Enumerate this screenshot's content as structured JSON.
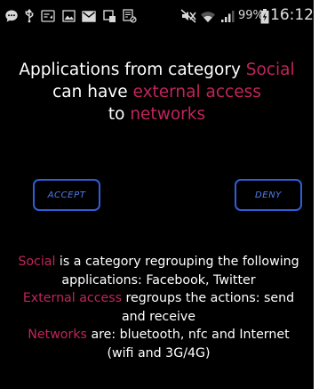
{
  "status_bar": {
    "icons": [
      "chat-bubble-icon",
      "usb-icon",
      "voicemail-icon",
      "image-icon",
      "mail-icon",
      "screen-share-icon",
      "blocked-app-icon",
      "mute-icon",
      "wifi-icon",
      "signal-icon",
      "battery-charging-icon"
    ],
    "battery": "99%",
    "time": "16:12"
  },
  "heading": {
    "line1_prefix": "Applications from category ",
    "line1_accent": "Social",
    "line2_prefix": "can have ",
    "line2_accent": "external access",
    "line3_prefix": "to ",
    "line3_accent": "networks"
  },
  "buttons": {
    "accept_label": "ACCEPT",
    "deny_label": "DENY"
  },
  "info": {
    "social_term": "Social",
    "social_desc_1": " is a category regrouping the following",
    "social_desc_2": "applications: Facebook, Twitter",
    "external_term": "External access",
    "external_desc_1": " regroups the actions: send",
    "external_desc_2": "and receive",
    "networks_term": "Networks",
    "networks_desc_1": " are: bluetooth, nfc and Internet",
    "networks_desc_2": "(wifi and 3G/4G)"
  },
  "colors": {
    "background": "#000000",
    "accent": "#c0245c",
    "button_border": "#2f5ed8",
    "button_text": "#4f7eee",
    "text": "#ffffff"
  }
}
